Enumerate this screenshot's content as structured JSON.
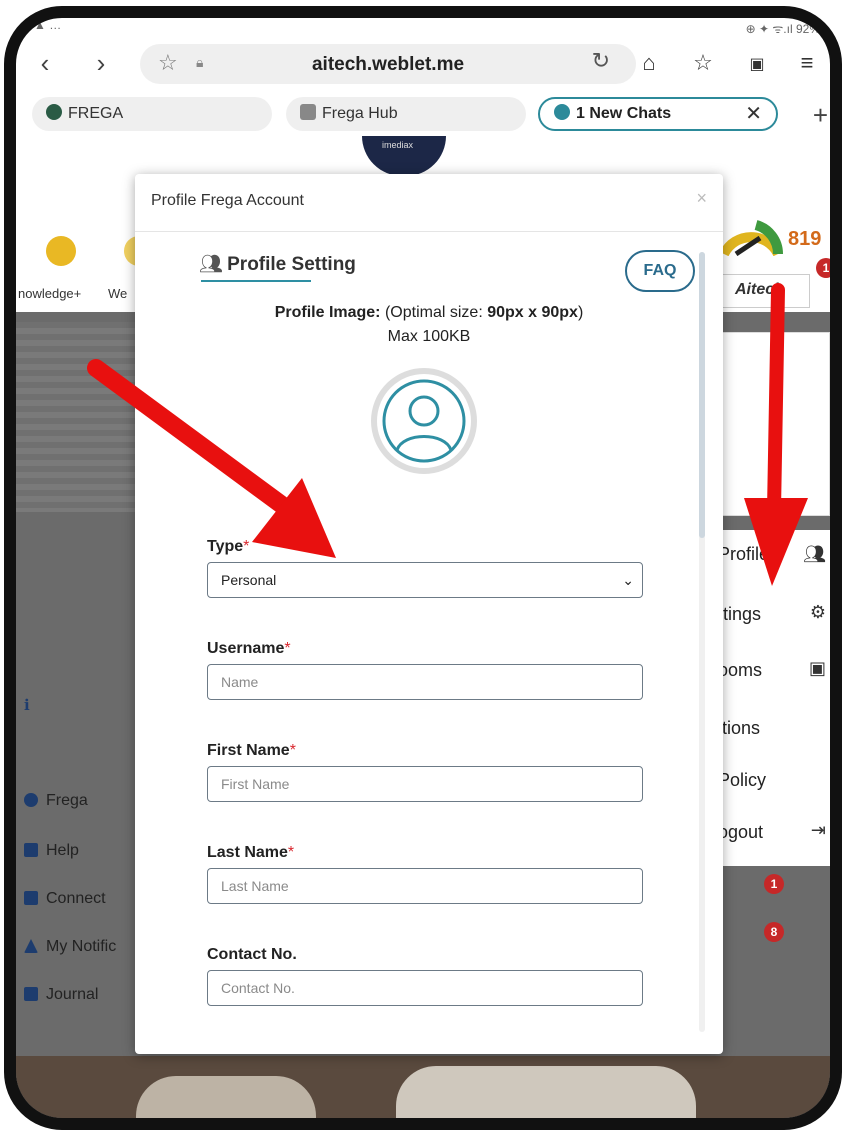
{
  "browser": {
    "url": "aitech.weblet.me",
    "status_right": "92%",
    "tabs": [
      {
        "label": "FREGA"
      },
      {
        "label": "Frega Hub"
      },
      {
        "label": "1 New Chats"
      }
    ]
  },
  "background": {
    "left_labels": [
      "nowledge+",
      "We"
    ],
    "score": "819",
    "aitech_label": "Aitech",
    "aitech_badge": "1",
    "left_menu": [
      "Frega",
      "Help",
      "Connect",
      "My Notific",
      "Journal"
    ],
    "right_menu": [
      "Profile",
      "ttings",
      "ooms",
      "itions",
      "Policy",
      "ogout"
    ],
    "badges": [
      "1",
      "8"
    ]
  },
  "modal": {
    "title": "Profile Frega Account",
    "close": "×",
    "section_heading": "Profile Setting",
    "faq_label": "FAQ",
    "profile_image_label": "Profile Image:",
    "profile_image_hint_a": "(Optimal size: ",
    "profile_image_size": "90px x 90px",
    "profile_image_hint_b": ")",
    "max_size": "Max 100KB",
    "fields": {
      "type": {
        "label": "Type",
        "value": "Personal"
      },
      "username": {
        "label": "Username",
        "placeholder": "Name"
      },
      "first_name": {
        "label": "First Name",
        "placeholder": "First Name"
      },
      "last_name": {
        "label": "Last Name",
        "placeholder": "Last Name"
      },
      "contact": {
        "label": "Contact No.",
        "placeholder": "Contact No."
      }
    }
  },
  "colors": {
    "accent": "#2e8fa3",
    "required": "#d9272e",
    "arrow": "#e8100f"
  }
}
